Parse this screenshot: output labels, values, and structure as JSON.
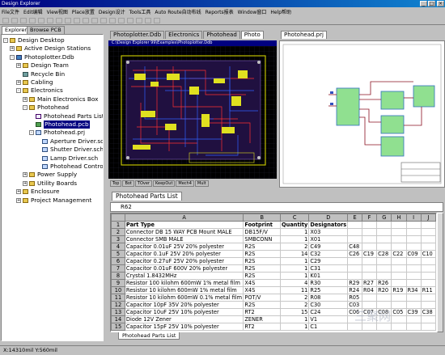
{
  "window": {
    "title": "Design Explorer"
  },
  "menu": [
    "File文件",
    "Edit编辑",
    "View视图",
    "Place放置",
    "Design设计",
    "Tools工具",
    "Auto Route自动布线",
    "Reports报表",
    "Window窗口",
    "Help帮助"
  ],
  "left_panel": {
    "tabs": [
      "Explorer",
      "Browse PCB"
    ],
    "tree": [
      {
        "label": "Design Desktop",
        "level": 0,
        "expander": "-",
        "icon": "desktop"
      },
      {
        "label": "Active Design Stations",
        "level": 1,
        "expander": "+",
        "icon": "folder"
      },
      {
        "label": "Photoplotter.Ddb",
        "level": 1,
        "expander": "-",
        "icon": "ddb"
      },
      {
        "label": "Design Team",
        "level": 2,
        "expander": "+",
        "icon": "folder"
      },
      {
        "label": "Recycle Bin",
        "level": 2,
        "expander": "",
        "icon": "bin"
      },
      {
        "label": "Cabling",
        "level": 2,
        "expander": "+",
        "icon": "folder"
      },
      {
        "label": "Electronics",
        "level": 2,
        "expander": "-",
        "icon": "folder"
      },
      {
        "label": "Main Electronics Box",
        "level": 3,
        "expander": "+",
        "icon": "folder"
      },
      {
        "label": "Photohead",
        "level": 3,
        "expander": "-",
        "icon": "folder"
      },
      {
        "label": "Photohead Parts List",
        "level": 4,
        "expander": "",
        "icon": "doc"
      },
      {
        "label": "Photohead.pcb",
        "level": 4,
        "expander": "",
        "icon": "pcb",
        "selected": true
      },
      {
        "label": "Photohead.prj",
        "level": 4,
        "expander": "-",
        "icon": "sch"
      },
      {
        "label": "Aperture Driver.sch",
        "level": 5,
        "expander": "",
        "icon": "sch"
      },
      {
        "label": "Shutter Driver.sch",
        "level": 5,
        "expander": "",
        "icon": "sch"
      },
      {
        "label": "Lamp Driver.sch",
        "level": 5,
        "expander": "",
        "icon": "sch"
      },
      {
        "label": "Photohead Controller",
        "level": 5,
        "expander": "",
        "icon": "sch"
      },
      {
        "label": "Power Supply",
        "level": 3,
        "expander": "+",
        "icon": "folder"
      },
      {
        "label": "Utility Boards",
        "level": 3,
        "expander": "+",
        "icon": "folder"
      },
      {
        "label": "Enclosure",
        "level": 2,
        "expander": "+",
        "icon": "folder"
      },
      {
        "label": "Project Management",
        "level": 2,
        "expander": "+",
        "icon": "folder"
      }
    ]
  },
  "pcb_panel": {
    "tabs": [
      "Photoplotter.Ddb",
      "Electronics",
      "Photohead",
      "Photo"
    ],
    "path": "C:\\Design Explorer 99\\Examples\\Photoplotter.Ddb",
    "layer_tabs": [
      "Top",
      "Bot",
      "TOver",
      "KeepOut",
      "Mech4",
      "Mult"
    ]
  },
  "sch_panel": {
    "tab": "Photohead.prj"
  },
  "sheet": {
    "tab": "Photohead Parts List",
    "cell_ref": "R62",
    "bottom_tab": "Photohead Parts List",
    "columns": [
      "A",
      "B",
      "C",
      "D",
      "E",
      "F",
      "G",
      "H",
      "I",
      "J"
    ],
    "header": [
      "Part Type",
      "Footprint",
      "Quantity",
      "Designators",
      "",
      "",
      "",
      "",
      "",
      ""
    ],
    "rows": [
      [
        "Connector DB 15 WAY PCB Mount MALE",
        "DB15F/V",
        "1",
        "X03",
        "",
        "",
        "",
        "",
        "",
        ""
      ],
      [
        "Connector SMB MALE",
        "SMBCONN",
        "1",
        "X01",
        "",
        "",
        "",
        "",
        "",
        ""
      ],
      [
        "Capacitor 0.01uF 25V 20% polyester",
        "R2S",
        "2",
        "C49",
        "C48",
        "",
        "",
        "",
        "",
        ""
      ],
      [
        "Capacitor 0.1uF 25V 20% polyester",
        "R2S",
        "14",
        "C32",
        "C26",
        "C19",
        "C28",
        "C22",
        "C09",
        "C10"
      ],
      [
        "Capacitor 0.27uF 25V 20% polyester",
        "R2S",
        "1",
        "C29",
        "",
        "",
        "",
        "",
        "",
        ""
      ],
      [
        "Capacitor 0.01uF 600V 20% polyester",
        "R2S",
        "1",
        "C31",
        "",
        "",
        "",
        "",
        "",
        ""
      ],
      [
        "Crystal 1.8432MHz",
        "R2S",
        "1",
        "K01",
        "",
        "",
        "",
        "",
        "",
        ""
      ],
      [
        "Resistor 100 kilohm 600mW 1% metal film",
        "X4S",
        "4",
        "R30",
        "R29",
        "R27",
        "R26",
        "",
        "",
        ""
      ],
      [
        "Resistor 10 kilohm 600mW 1% metal film",
        "X4S",
        "11",
        "R25",
        "R24",
        "R04",
        "R20",
        "R19",
        "R34",
        "R11"
      ],
      [
        "Resistor 10 kilohm 600mW 0.1% metal film",
        "POT/V",
        "2",
        "R08",
        "R05",
        "",
        "",
        "",
        "",
        ""
      ],
      [
        "Capacitor 10pF 35V 20% polyester",
        "R2S",
        "2",
        "C30",
        "C03",
        "",
        "",
        "",
        "",
        ""
      ],
      [
        "Capacitor 10uF 25V 10% polyester",
        "RT2",
        "15",
        "C24",
        "C06",
        "C07",
        "C08",
        "C05",
        "C39",
        "C38"
      ],
      [
        "Diode 12V Zener",
        "ZENER",
        "1",
        "V1",
        "",
        "",
        "",
        "",
        "",
        ""
      ],
      [
        "Capacitor 15pF 25V 10% polyester",
        "RT2",
        "1",
        "C1",
        "",
        "",
        "",
        "",
        "",
        ""
      ]
    ]
  },
  "status": {
    "coords": "X:14310mil Y:560mil"
  },
  "watermark": "三聚网"
}
